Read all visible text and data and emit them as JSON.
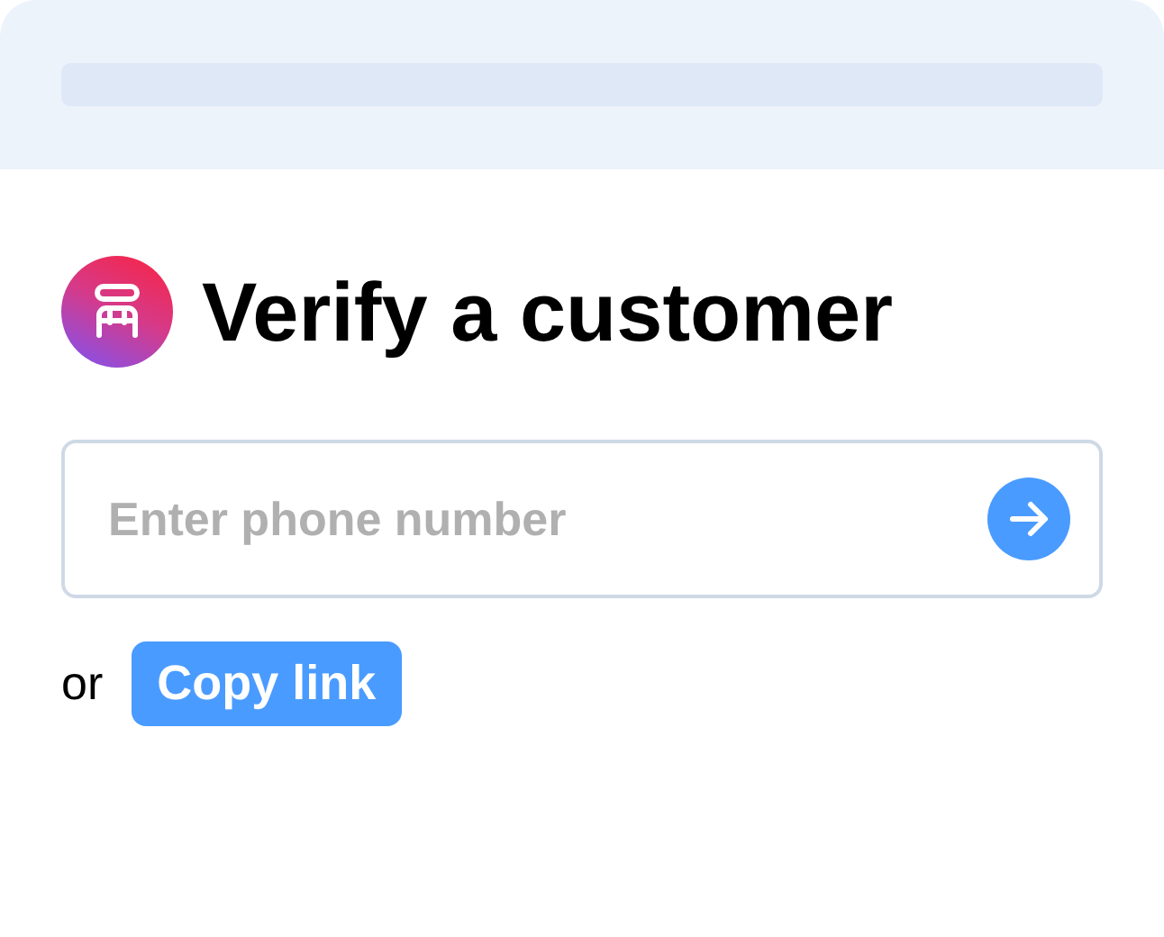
{
  "title": "Verify a customer",
  "phone_field": {
    "placeholder": "Enter phone number"
  },
  "alternative": {
    "prefix": "or",
    "button": "Copy link"
  }
}
